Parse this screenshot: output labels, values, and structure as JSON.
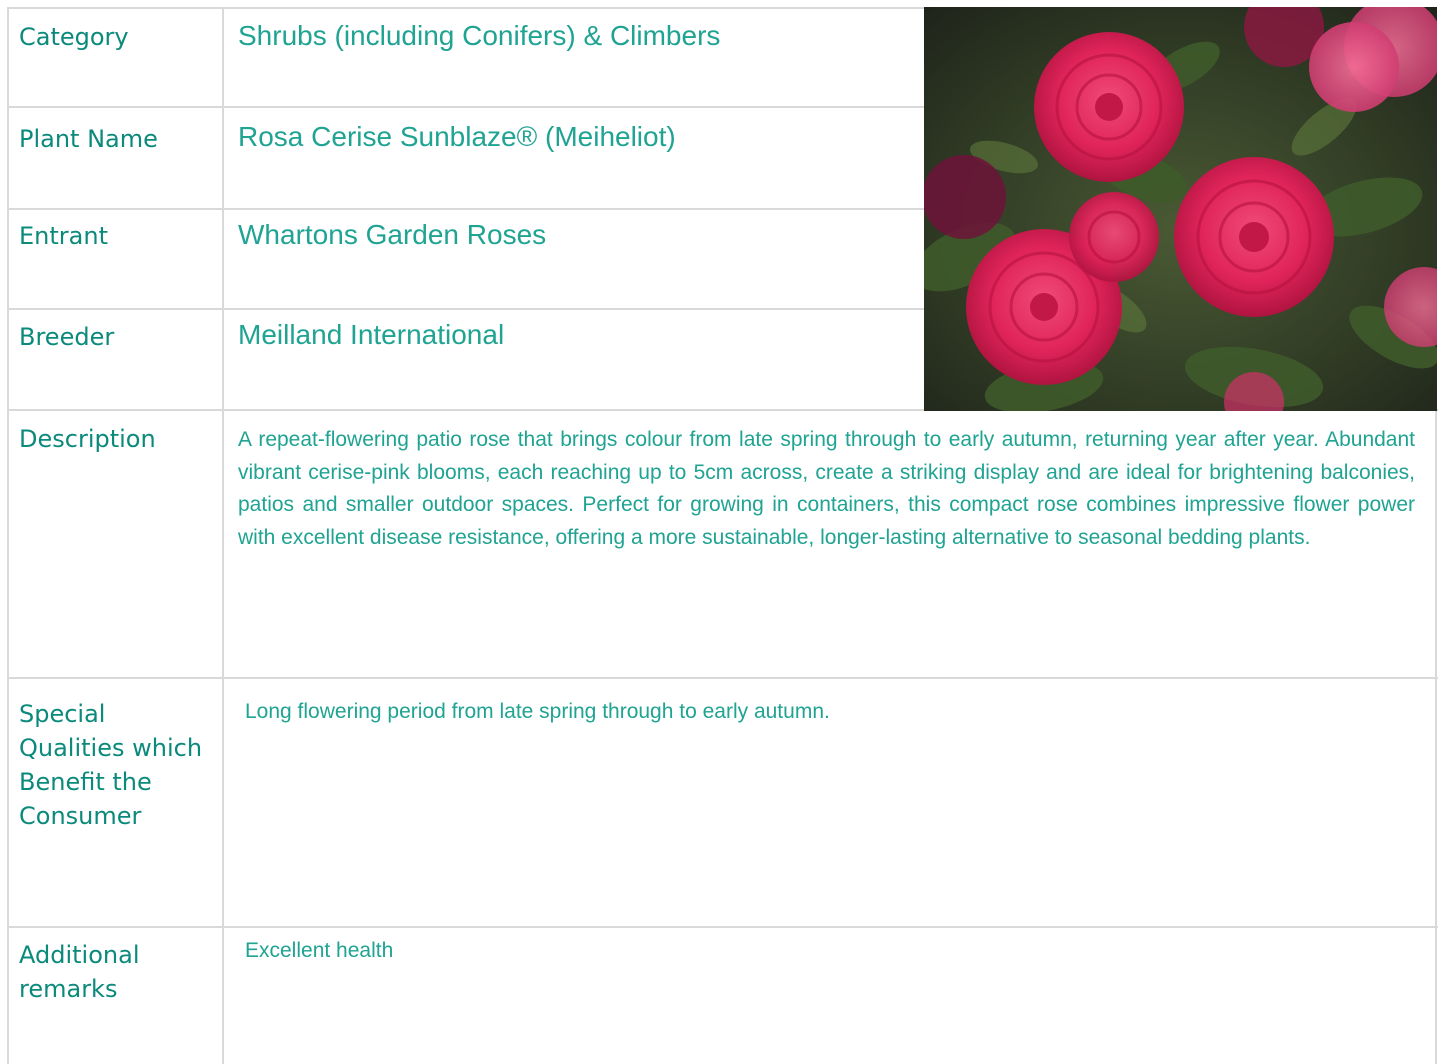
{
  "rows": {
    "category": {
      "label": "Category",
      "value": "Shrubs (including Conifers) & Climbers"
    },
    "plant_name": {
      "label": "Plant Name",
      "value": "Rosa Cerise Sunblaze® (Meiheliot)"
    },
    "entrant": {
      "label": "Entrant",
      "value": "Whartons Garden Roses"
    },
    "breeder": {
      "label": "Breeder",
      "value": "Meilland International"
    },
    "description": {
      "label": "Description",
      "value": "A repeat-flowering patio rose that brings colour from late spring through to early autumn, returning year after year. Abundant vibrant cerise-pink blooms, each reaching up to 5cm across, create a striking display and are ideal for brightening balconies, patios and smaller outdoor spaces. Perfect for growing in containers, this compact rose combines impressive flower power with excellent disease resistance, offering a more sustainable, longer-lasting alternative to seasonal bedding plants."
    },
    "special_qualities": {
      "label_lines": [
        "Special",
        "Qualities which",
        "Benefit the",
        "Consumer"
      ],
      "value": "Long flowering period from late spring through to early autumn."
    },
    "additional_remarks": {
      "label_lines": [
        "Additional",
        "remarks"
      ],
      "value": "Excellent health"
    }
  },
  "photo": {
    "icon": "rose-photo",
    "colors": {
      "bloom": "#e0245a",
      "bloom_dark": "#b5123f",
      "foliage": "#3d5a2a",
      "background": "#2a2f22"
    }
  },
  "colors": {
    "label": "#0b8a7c",
    "value": "#1fa392",
    "grid": "#d9d9d9"
  }
}
